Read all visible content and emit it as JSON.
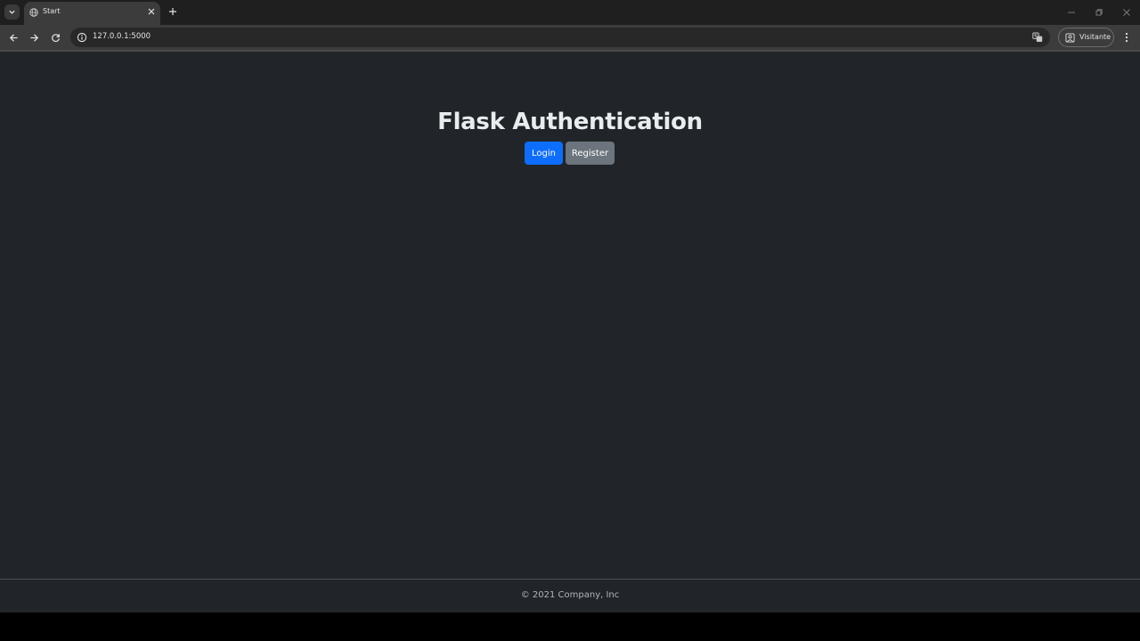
{
  "browser": {
    "tab": {
      "title": "Start"
    },
    "address": {
      "url": "127.0.0.1:5000"
    },
    "profile": {
      "label": "Visitante"
    }
  },
  "page": {
    "heading": "Flask Authentication",
    "buttons": {
      "login": "Login",
      "register": "Register"
    },
    "footer": "© 2021 Company, Inc"
  },
  "colors": {
    "background": "#212529",
    "primary": "#0d6efd",
    "secondary": "#6c757d",
    "chrome_bg": "#3c3c3c"
  },
  "icons": {
    "tab_search": "chevron-down-icon",
    "tab_favicon": "globe-icon",
    "tab_close": "close-icon",
    "new_tab": "plus-icon",
    "back": "arrow-left-icon",
    "forward": "arrow-right-icon",
    "reload": "reload-icon",
    "site_info": "info-icon",
    "translate": "translate-icon",
    "profile": "profile-icon",
    "menu": "kebab-menu-icon"
  }
}
